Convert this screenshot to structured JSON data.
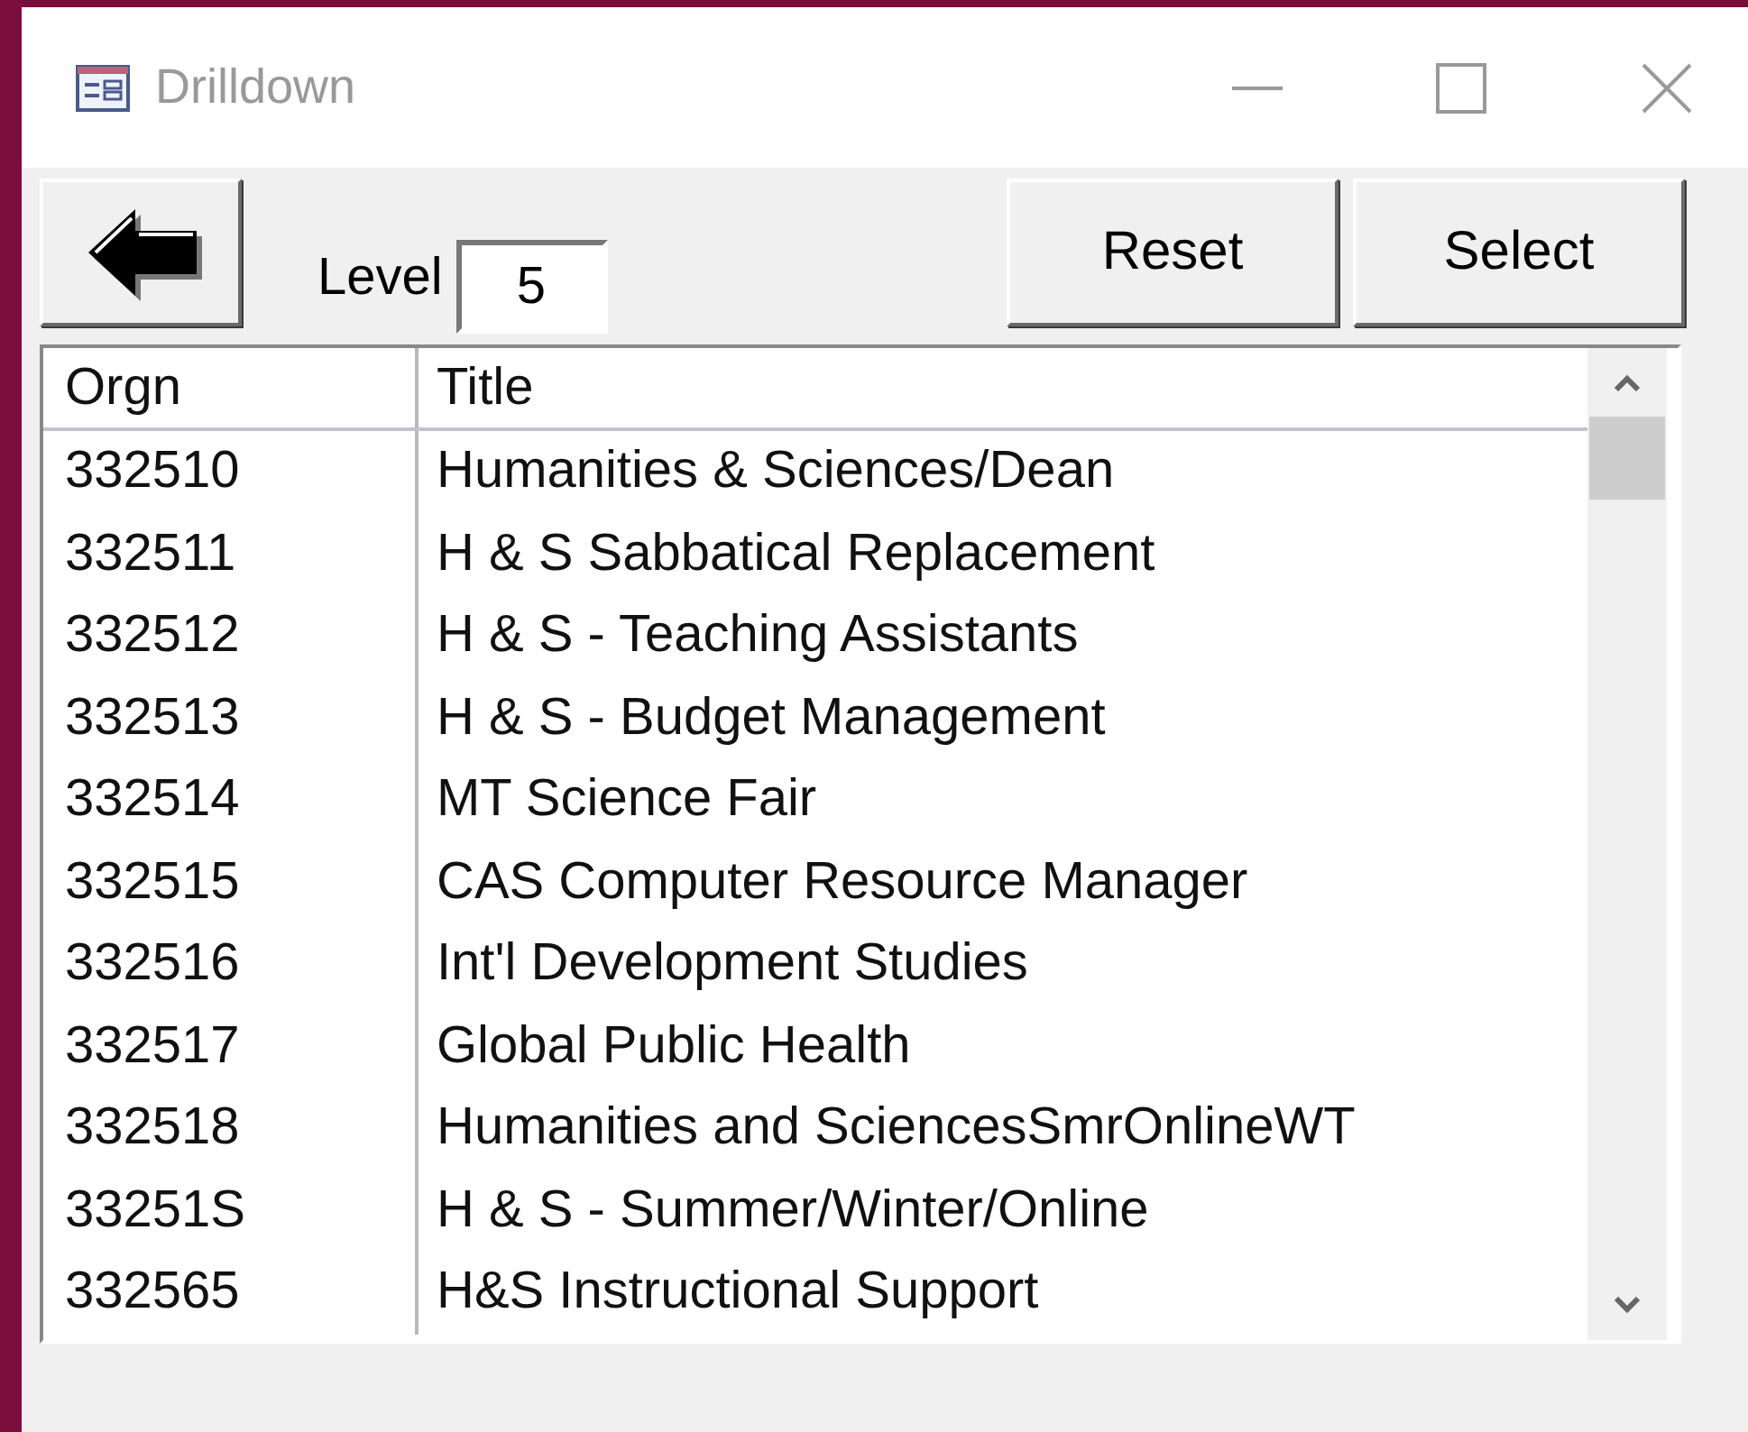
{
  "window": {
    "title": "Drilldown"
  },
  "toolbar": {
    "level_label": "Level",
    "level_value": "5",
    "buttons": [
      "Reset",
      "Select"
    ]
  },
  "table": {
    "columns": [
      "Orgn",
      "Title"
    ],
    "rows": [
      [
        "332510",
        "Humanities & Sciences/Dean"
      ],
      [
        "332511",
        "H & S Sabbatical Replacement"
      ],
      [
        "332512",
        "H & S - Teaching Assistants"
      ],
      [
        "332513",
        "H & S - Budget Management"
      ],
      [
        "332514",
        "MT Science Fair"
      ],
      [
        "332515",
        "CAS Computer Resource Manager"
      ],
      [
        "332516",
        "Int'l Development Studies"
      ],
      [
        "332517",
        "Global Public Health"
      ],
      [
        "332518",
        "Humanities and SciencesSmrOnlineWT"
      ],
      [
        "33251S",
        "H & S - Summer/Winter/Online"
      ],
      [
        "332565",
        "H&S Instructional Support"
      ]
    ]
  }
}
